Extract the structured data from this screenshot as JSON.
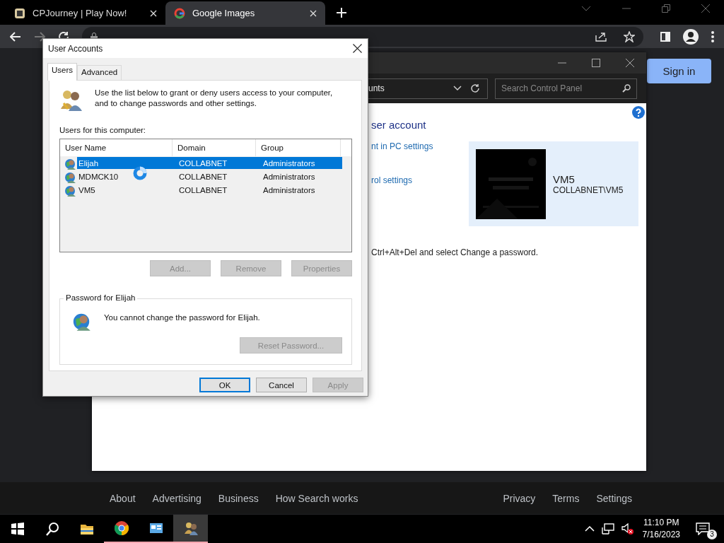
{
  "browser": {
    "tabs": [
      {
        "title": "CPJourney | Play Now!",
        "selected": false,
        "kind": "cpj"
      },
      {
        "title": "Google Images",
        "selected": true,
        "kind": "google"
      }
    ],
    "sign_in": "Sign in",
    "footer_left": [
      "About",
      "Advertising",
      "Business",
      "How Search works"
    ],
    "footer_right": [
      "Privacy",
      "Terms",
      "Settings"
    ]
  },
  "control_panel": {
    "breadcrumb": "unts",
    "search_placeholder": "Search Control Panel",
    "heading": "ser account",
    "links": [
      "nt in PC settings",
      "rol settings"
    ],
    "account": {
      "name": "VM5",
      "domain": "COLLABNET\\VM5"
    },
    "note": "Ctrl+Alt+Del and select Change a password."
  },
  "dialog": {
    "title": "User Accounts",
    "tabs": [
      {
        "label": "Users",
        "selected": true
      },
      {
        "label": "Advanced",
        "selected": false
      }
    ],
    "intro": "Use the list below to grant or deny users access to your computer, and to change passwords and other settings.",
    "list_label": "Users for this computer:",
    "columns": [
      "User Name",
      "Domain",
      "Group"
    ],
    "rows": [
      {
        "user": "Elijah",
        "domain": "COLLABNET",
        "group": "Administrators",
        "selected": true
      },
      {
        "user": "MDMCK10",
        "domain": "COLLABNET",
        "group": "Administrators",
        "selected": false
      },
      {
        "user": "VM5",
        "domain": "COLLABNET",
        "group": "Administrators",
        "selected": false
      }
    ],
    "list_buttons": [
      {
        "label": "Add...",
        "disabled": true
      },
      {
        "label": "Remove",
        "disabled": true
      },
      {
        "label": "Properties",
        "disabled": true
      }
    ],
    "password_group": "Password for Elijah",
    "password_message": "You cannot change the password for Elijah.",
    "reset_button": {
      "label": "Reset Password...",
      "disabled": true
    },
    "buttons": [
      {
        "label": "OK",
        "disabled": false,
        "default": true
      },
      {
        "label": "Cancel",
        "disabled": false,
        "default": false
      },
      {
        "label": "Apply",
        "disabled": true,
        "default": false
      }
    ]
  },
  "taskbar": {
    "apps": [
      {
        "kind": "start",
        "running": false,
        "active": false
      },
      {
        "kind": "search",
        "running": false,
        "active": false
      },
      {
        "kind": "folder",
        "running": false,
        "active": false
      },
      {
        "kind": "chrome",
        "running": true,
        "active": false
      },
      {
        "kind": "panel",
        "running": true,
        "active": false
      },
      {
        "kind": "users",
        "running": true,
        "active": true
      }
    ],
    "time": "11:10 PM",
    "date": "7/16/2023",
    "notifications": "3"
  }
}
